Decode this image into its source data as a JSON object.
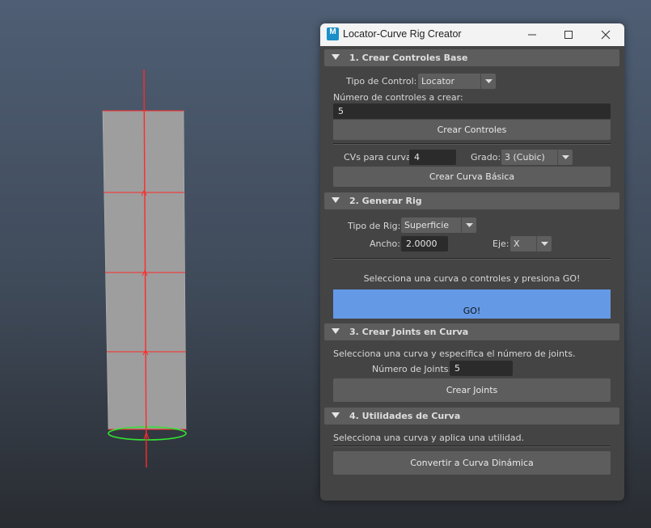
{
  "window": {
    "title": "Locator-Curve Rig Creator",
    "app_icon_letter": "M"
  },
  "section1": {
    "header": "1. Crear Controles Base",
    "control_type_label": "Tipo de Control:",
    "control_type_value": "Locator",
    "num_controls_label": "Número de controles a crear:",
    "num_controls_value": "5",
    "create_controls_button": "Crear Controles",
    "cvs_label": "CVs para curva:",
    "cvs_value": "4",
    "degree_label": "Grado:",
    "degree_value": "3 (Cubic)",
    "create_curve_button": "Crear Curva Básica"
  },
  "section2": {
    "header": "2. Generar Rig",
    "rig_type_label": "Tipo de Rig:",
    "rig_type_value": "Superficie",
    "width_label": "Ancho:",
    "width_value": "2.0000",
    "axis_label": "Eje:",
    "axis_value": "X",
    "instruction": "Selecciona una curva o controles y presiona GO!",
    "go_button": "GO!"
  },
  "section3": {
    "header": "3. Crear Joints en Curva",
    "instruction": "Selecciona una curva y especifica el número de joints.",
    "num_joints_label": "Número de Joints:",
    "num_joints_value": "5",
    "create_joints_button": "Crear Joints"
  },
  "section4": {
    "header": "4. Utilidades de Curva",
    "instruction": "Selecciona una curva y aplica una utilidad.",
    "convert_button": "Convertir a Curva Dinámica"
  },
  "colors": {
    "go_button": "#6499e6",
    "window_bg": "#444444",
    "section_header": "#5d5d5d",
    "field_bg": "#2b2b2b",
    "viewport_mesh": "#9e9e9e",
    "joint_line": "#ff2a2a",
    "curve_circle": "#33e233"
  }
}
